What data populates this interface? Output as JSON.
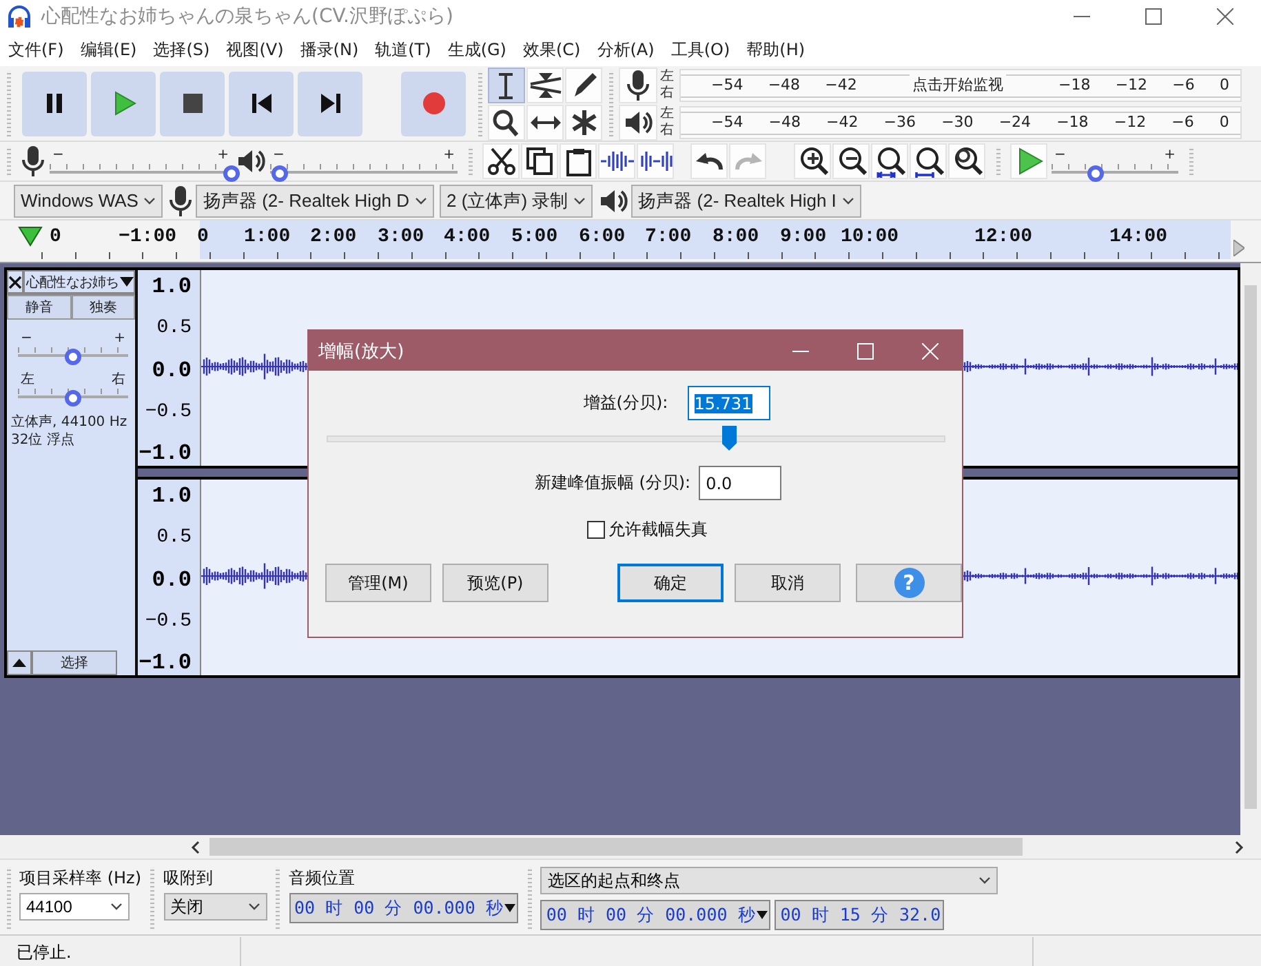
{
  "window": {
    "title": "心配性なお姉ちゃんの泉ちゃん(CV.沢野ぽぷら)"
  },
  "menu": [
    "文件(F)",
    "编辑(E)",
    "选择(S)",
    "视图(V)",
    "播录(N)",
    "轨道(T)",
    "生成(G)",
    "效果(C)",
    "分析(A)",
    "工具(O)",
    "帮助(H)"
  ],
  "tools": [
    {
      "kind": "select",
      "selected": true
    },
    {
      "kind": "envelope",
      "selected": false
    },
    {
      "kind": "draw",
      "selected": false
    },
    {
      "kind": "zoom",
      "selected": false
    },
    {
      "kind": "timeshift",
      "selected": false
    },
    {
      "kind": "multi",
      "selected": false
    }
  ],
  "meters": {
    "record": {
      "channels": [
        "左",
        "右"
      ],
      "ticks_before": [
        "−54",
        "−48",
        "−42"
      ],
      "message": "点击开始监视",
      "ticks_after": [
        "−18",
        "−12",
        "−6",
        "0"
      ]
    },
    "playback": {
      "channels": [
        "左",
        "右"
      ],
      "ticks": [
        "−54",
        "−48",
        "−42",
        "−36",
        "−30",
        "−24",
        "−18",
        "−12",
        "−6",
        "0"
      ]
    }
  },
  "mixer": {
    "record": {
      "minus": "−",
      "plus": "+",
      "level": 1
    },
    "playback": {
      "minus": "−",
      "plus": "+",
      "level": 0.05
    }
  },
  "history": [
    {
      "kind": "undo",
      "disabled": false
    },
    {
      "kind": "redo",
      "disabled": true
    }
  ],
  "play_at_speed": {
    "minus": "−",
    "plus": "+",
    "level": 0.35
  },
  "devices": {
    "host": "Windows WAS",
    "recording_device": "扬声器 (2- Realtek High D",
    "channels": "2 (立体声) 录制",
    "playback_device": "扬声器 (2- Realtek High I"
  },
  "ruler": {
    "labels": [
      "0",
      "−1:00",
      "0",
      "1:00",
      "2:00",
      "3:00",
      "4:00",
      "5:00",
      "6:00",
      "7:00",
      "8:00",
      "9:00",
      "10:00",
      "12:00",
      "14:00"
    ]
  },
  "track": {
    "name": "心配性なお姉ち",
    "mute": "静音",
    "solo": "独奏",
    "gain": {
      "minus": "−",
      "plus": "+",
      "level": 0.5
    },
    "pan": {
      "left": "左",
      "right": "右",
      "level": 0.5
    },
    "info": [
      "立体声, 44100 Hz",
      "32位 浮点"
    ],
    "select": "选择",
    "channels": [
      {
        "scale": [
          "1.0",
          "0.5",
          "0.0",
          "−0.5",
          "−1.0"
        ]
      },
      {
        "scale": [
          "1.0",
          "0.5",
          "0.0",
          "−0.5",
          "−1.0"
        ]
      }
    ]
  },
  "dialog": {
    "title": "增幅(放大)",
    "gain_label": "增益(分贝):",
    "gain_value": "15.731",
    "gain_slider": {
      "level": 0.65
    },
    "peak_label": "新建峰值振幅 (分贝):",
    "peak_value": "0.0",
    "clipping": {
      "label": "允许截幅失真",
      "checked": false
    },
    "buttons": [
      {
        "label": "管理(M)",
        "kind": "normal"
      },
      {
        "label": "预览(P)",
        "kind": "normal"
      },
      {
        "label": "确定",
        "kind": "default"
      },
      {
        "label": "取消",
        "kind": "normal"
      }
    ],
    "help": "?"
  },
  "selection_bar": {
    "rate": {
      "label": "项目采样率 (Hz)",
      "value": "44100"
    },
    "snap": {
      "label": "吸附到",
      "value": "关闭"
    },
    "position": {
      "label": "音频位置",
      "value": "00 时 00 分 00.000 秒"
    },
    "selection": {
      "label": "选区的起点和终点",
      "start": "00 时 00 分 00.000 秒",
      "end": "00 时 15 分 32.0"
    }
  },
  "status_bar": {
    "text": "已停止."
  }
}
